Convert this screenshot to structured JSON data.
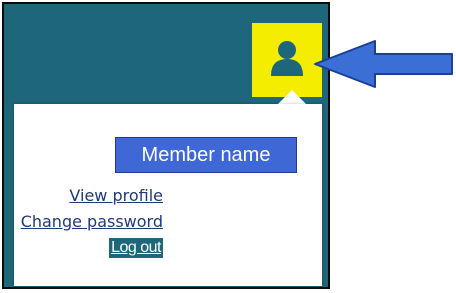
{
  "header": {
    "user_icon": "user-icon",
    "background_color": "#1e6679",
    "button_color": "#f5ed00"
  },
  "menu": {
    "member_name": "Member name",
    "view_profile": "View profile",
    "change_password": "Change password",
    "log_out": "Log out"
  },
  "annotation": {
    "arrow_icon": "arrow-left-icon",
    "arrow_color": "#3c6fd6"
  }
}
